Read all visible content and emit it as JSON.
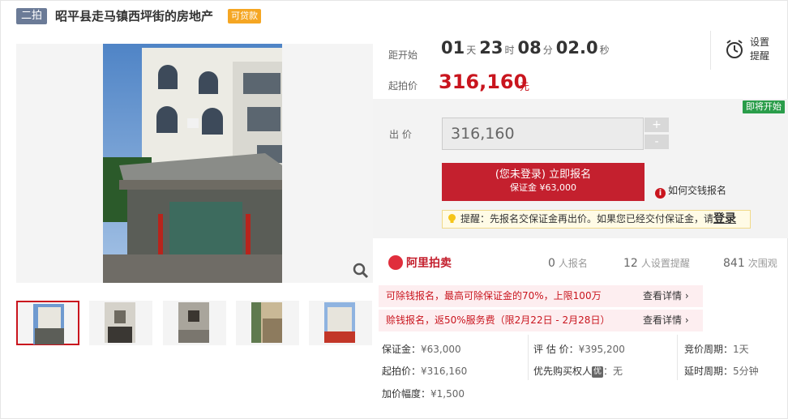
{
  "header": {
    "round_badge": "二拍",
    "title": "昭平县走马镇西坪街的房地产",
    "loan_tag": "可贷款"
  },
  "countdown": {
    "label": "距开始",
    "days": "01",
    "days_unit": "天",
    "hours": "23",
    "hours_unit": "时",
    "minutes": "08",
    "minutes_unit": "分",
    "seconds": "02.0",
    "seconds_unit": "秒"
  },
  "reminder": {
    "label": "设置提醒"
  },
  "start_price": {
    "label": "起拍价",
    "value": "316,160",
    "unit": "元"
  },
  "bid": {
    "status_tag": "即将开始",
    "label": "出 价",
    "input_value": "316,160",
    "plus": "+",
    "minus": "-",
    "signup_line1": "(您未登录) 立即报名",
    "signup_line2": "保证金 ¥63,000",
    "how_to_pay": "如何交钱报名",
    "tip_text": "提醒：先报名交保证金再出价。如果您已经交付保证金，请",
    "tip_login": "登录"
  },
  "platform": {
    "name": "阿里拍卖",
    "signups_count": "0",
    "signups_label": "人报名",
    "reminders_count": "12",
    "reminders_label": "人设置提醒",
    "views_count": "841",
    "views_label": "次围观"
  },
  "promos": [
    {
      "text": "可除钱报名，最高可除保证金的70%，上限100万",
      "link": "查看详情"
    },
    {
      "text": "赊钱报名，返50%服务费（限2月22日 - 2月28日）",
      "link": "查看详情"
    }
  ],
  "info": {
    "deposit_label": "保证金：",
    "deposit": "¥63,000",
    "appraisal_label": "评 估 价：",
    "appraisal": "¥395,200",
    "cycle_label": "竞价周期：",
    "cycle": "1天",
    "start_label": "起拍价：",
    "start": "¥316,160",
    "priority_label": "优先购买权人",
    "priority_tag": "优",
    "priority": "：无",
    "delay_label": "延时周期：",
    "delay": "5分钟",
    "increment_label": "加价幅度：",
    "increment": "¥1,500"
  },
  "icons": {
    "zoom": "magnifier-icon",
    "alarm": "alarm-clock-icon",
    "info": "info-icon",
    "tip": "lightbulb-icon"
  },
  "colors": {
    "accent": "#c9151e",
    "badge": "#6b7b97",
    "loan": "#f5a623",
    "soon": "#2a9d4a"
  }
}
